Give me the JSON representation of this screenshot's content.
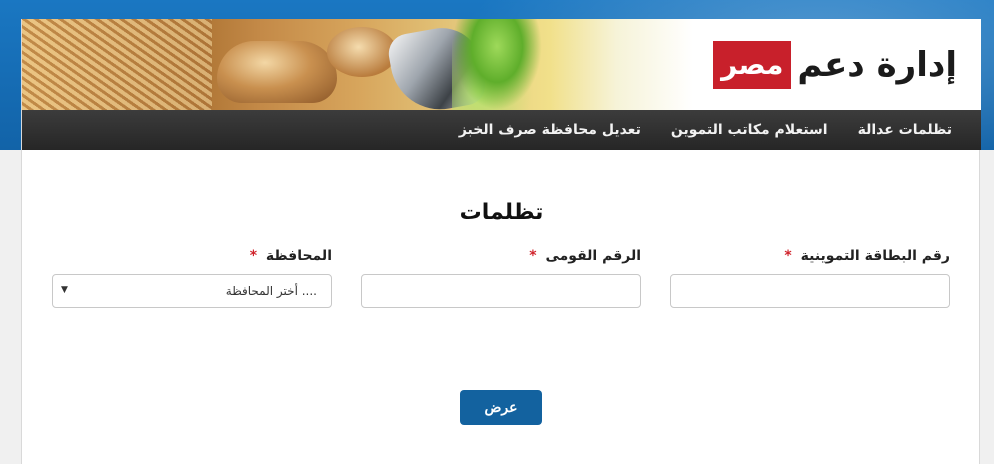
{
  "header": {
    "logo_text": "إدارة دعم",
    "logo_highlight": "مصر"
  },
  "nav": {
    "items": [
      {
        "label": "تظلمات عدالة"
      },
      {
        "label": "استعلام مكاتب التموين"
      },
      {
        "label": "تعديل محافظة صرف الخبز"
      }
    ]
  },
  "form": {
    "title": "تظلمات",
    "required_mark": "*",
    "card_number": {
      "label": "رقم البطاقة التموينية",
      "value": "",
      "placeholder": ""
    },
    "national_id": {
      "label": "الرقم القومى",
      "value": "",
      "placeholder": ""
    },
    "governorate": {
      "label": "المحافظة",
      "selected": "أختر المحافظة ...."
    },
    "submit_label": "عرض"
  },
  "colors": {
    "accent": "#13629f",
    "navbar": "#2d2d2d",
    "required": "#d0222b",
    "logo_box": "#c8202b"
  }
}
